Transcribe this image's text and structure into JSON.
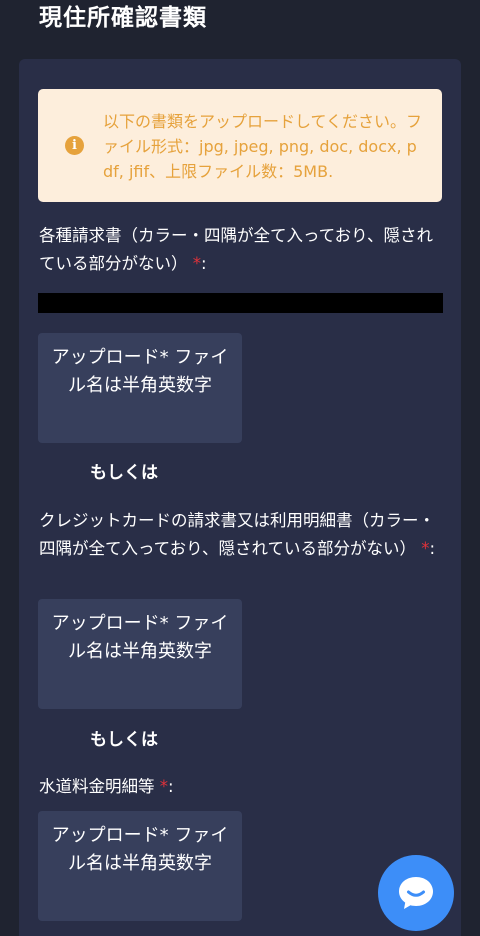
{
  "page": {
    "title": "現住所確認書類"
  },
  "notice": {
    "icon": "info-icon",
    "icon_glyph": "i",
    "text": "以下の書類をアップロードしてください。ファイル形式：jpg, jpeg, png, doc, docx, pdf, jfif、上限ファイル数：5MB.",
    "colors": {
      "background": "#fdeedc",
      "text": "#e6a23c"
    }
  },
  "fields": [
    {
      "label": "各種請求書（カラー・四隅が全て入っており、隠されている部分がない）",
      "required_mark": "*",
      "suffix": ":",
      "upload_button": "アップロード* ファイル名は半角英数字"
    },
    {
      "label": "クレジットカードの請求書又は利用明細書（カラー・四隅が全て入っており、隠されている部分がない）",
      "required_mark": "*",
      "suffix": ":",
      "upload_button": "アップロード* ファイル名は半角英数字"
    },
    {
      "label": "水道料金明細等",
      "required_mark": "*",
      "suffix": ":",
      "upload_button": "アップロード* ファイル名は半角英数字"
    }
  ],
  "separators": {
    "or_1": "もしくは",
    "or_2": "もしくは"
  },
  "chat": {
    "icon": "chat-bubble-icon"
  },
  "colors": {
    "page_background": "#1f2330",
    "card_background": "#292e47",
    "button_background": "#373f5c",
    "required": "#e0323a",
    "chat_button": "#3d8ef8"
  }
}
